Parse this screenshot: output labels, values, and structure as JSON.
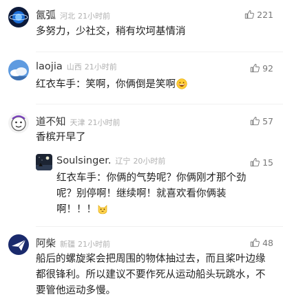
{
  "comments": [
    {
      "username": "氤弧",
      "location": "河北",
      "time": "21小时前",
      "likes": "221",
      "text": "多努力，少社交，稍有坎坷基情消",
      "avatar_icon": "planet-icon"
    },
    {
      "username": "laojia",
      "location": "山西",
      "time": "21小时前",
      "likes": "92",
      "text": "红衣车手：笑啊，你俩倒是笑啊",
      "emoji": "grinning-face",
      "avatar_icon": "sky-cloud-icon"
    },
    {
      "username": "道不知",
      "location": "天津",
      "time": "21小时前",
      "likes": "57",
      "text": "香槟开早了",
      "avatar_icon": "cartoon-face-icon",
      "replies": [
        {
          "username": "Soulsinger.",
          "location": "辽宁",
          "time": "20小时前",
          "likes": "15",
          "text": "红衣车手：你俩的气势呢？你俩刚才那个劲呢？别停啊！继续啊！就喜欢看你俩装啊！！！",
          "emoji": "cat-face",
          "avatar_icon": "night-sky-icon"
        }
      ]
    },
    {
      "username": "阿柴",
      "location": "新疆",
      "time": "21小时前",
      "likes": "48",
      "text": "船后的螺旋桨会把周围的物体抽过去，而且桨叶边缘都很锋利。所以建议不要作死从运动船头玩跳水，不要管他运动多慢。",
      "avatar_icon": "paper-plane-icon"
    }
  ]
}
